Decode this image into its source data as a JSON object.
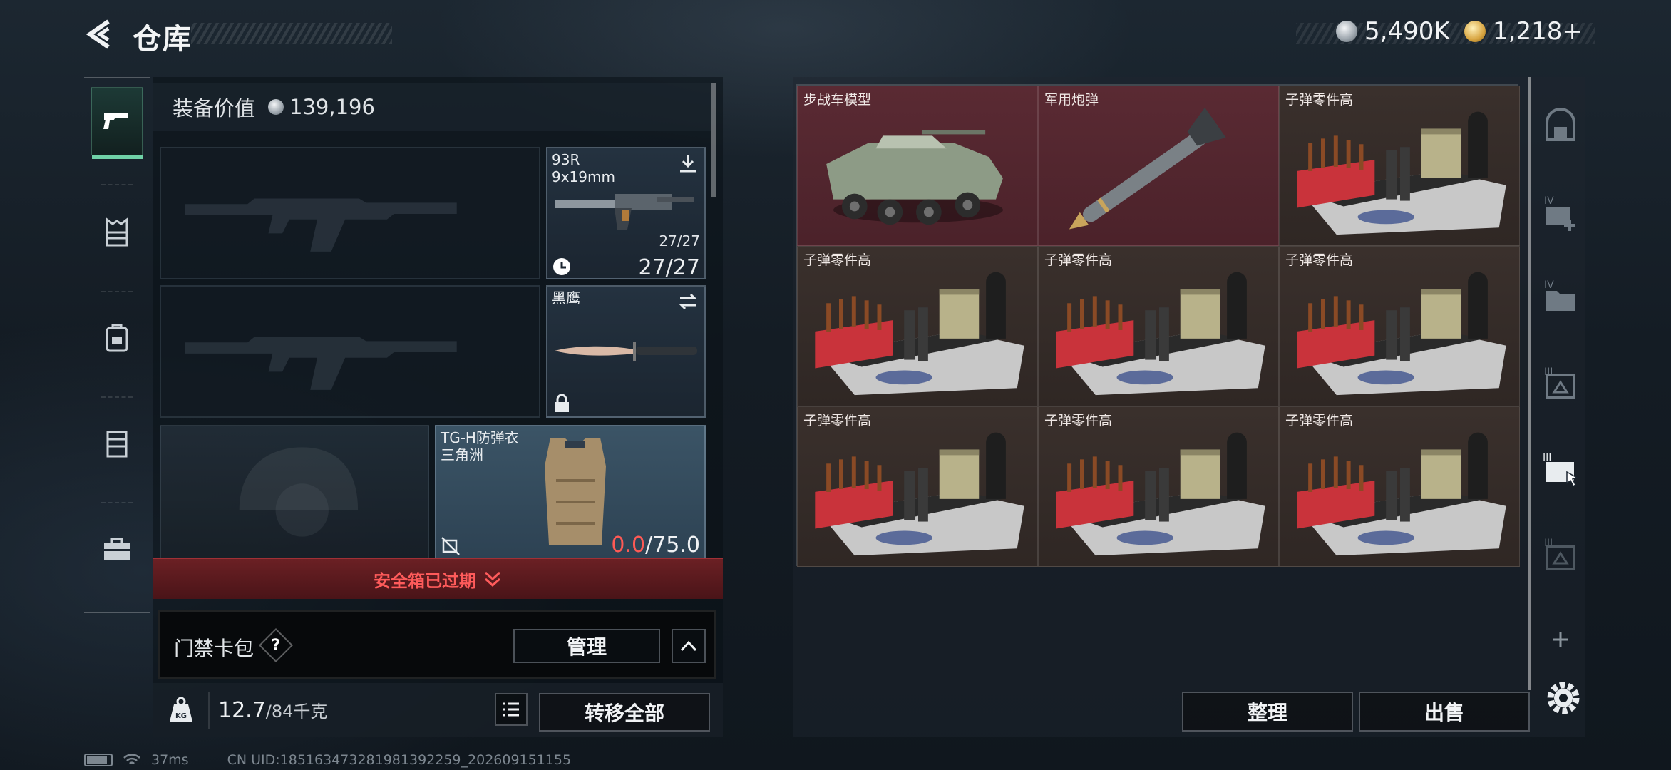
{
  "header": {
    "title": "仓库",
    "currency_silver": "5,490K",
    "currency_gold": "1,218+"
  },
  "loadout": {
    "value_label": "装备价值",
    "value": "139,196",
    "secondary": {
      "name": "93R",
      "caliber": "9x19mm",
      "ammo_small": "27/27",
      "ammo_big": "27/27"
    },
    "melee": {
      "name": "黑鹰"
    },
    "vest": {
      "name": "TG-H防弹衣",
      "subtitle": "三角洲",
      "durability_current": "0.0",
      "durability_max": "/75.0"
    },
    "safe_box_banner": "安全箱已过期",
    "keycard_label": "门禁卡包",
    "help_glyph": "?",
    "manage_label": "管理",
    "weight_value": "12.7",
    "weight_max": "/84千克",
    "transfer_all_label": "转移全部"
  },
  "storage": {
    "items": [
      {
        "name": "步战车模型",
        "type": "ifv",
        "bg": "red"
      },
      {
        "name": "军用炮弹",
        "type": "shell",
        "bg": "red"
      },
      {
        "name": "子弹零件高",
        "type": "ammo",
        "bg": "brown"
      },
      {
        "name": "子弹零件高",
        "type": "ammo",
        "bg": "brown"
      },
      {
        "name": "子弹零件高",
        "type": "ammo",
        "bg": "brown"
      },
      {
        "name": "子弹零件高",
        "type": "ammo",
        "bg": "brown"
      },
      {
        "name": "子弹零件高",
        "type": "ammo",
        "bg": "brown"
      },
      {
        "name": "子弹零件高",
        "type": "ammo",
        "bg": "brown"
      },
      {
        "name": "子弹零件高",
        "type": "ammo",
        "bg": "brown"
      }
    ],
    "sort_label": "整理",
    "sell_label": "出售"
  },
  "rail": {
    "items": [
      "pistol-icon",
      "vest-icon",
      "backpack-icon",
      "chest-rig-icon",
      "toolbox-icon"
    ]
  },
  "right_rail": {
    "items": [
      "safe-icon",
      "container-add-icon",
      "container-folder-icon",
      "container-icon",
      "container-selected-icon",
      "container-dim-icon",
      "plus-icon"
    ]
  },
  "status": {
    "ping": "37ms",
    "uid": "CN UID:185163473281981392259_202609151155"
  },
  "colors": {
    "accent_green": "#6fd1a6",
    "alert_red": "#ff5b5b",
    "durability_red": "#ff5a55",
    "cell_red": "#5a2a33",
    "cell_brown": "#3a302c"
  }
}
